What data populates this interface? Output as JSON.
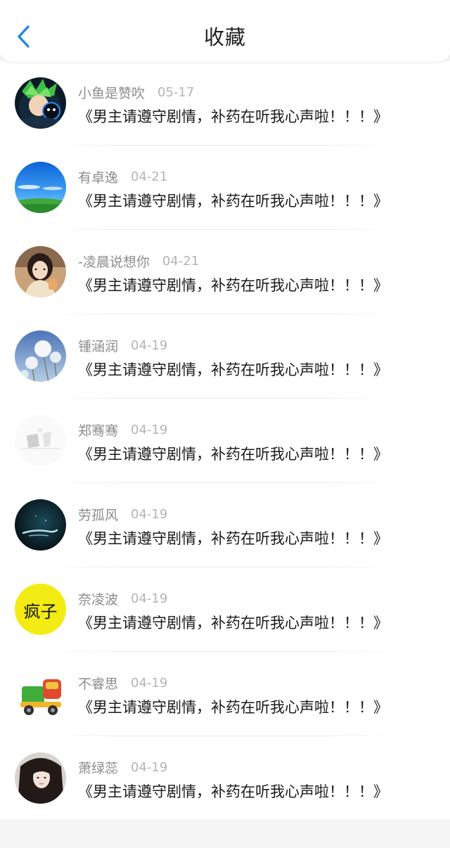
{
  "header": {
    "title": "收藏",
    "back_icon": "chevron-left-icon",
    "accent_color": "#1e88e5"
  },
  "items": [
    {
      "name": "小鱼是赞吹",
      "date": "05-17",
      "book": "《男主请遵守剧情，补药在听我心声啦！！！》",
      "avatar": "anime-character-green-hair"
    },
    {
      "name": "有卓逸",
      "date": "04-21",
      "book": "《男主请遵守剧情，补药在听我心声啦！！！》",
      "avatar": "blue-sky-grass"
    },
    {
      "name": "-凌晨说想你",
      "date": "04-21",
      "book": "《男主请遵守剧情，补药在听我心声啦！！！》",
      "avatar": "girl-portrait"
    },
    {
      "name": "锺涵润",
      "date": "04-19",
      "book": "《男主请遵守剧情，补药在听我心声啦！！！》",
      "avatar": "white-flowers"
    },
    {
      "name": "郑骞骞",
      "date": "04-19",
      "book": "《男主请遵守剧情，补药在听我心声啦！！！》",
      "avatar": "grey-sketch"
    },
    {
      "name": "劳孤风",
      "date": "04-19",
      "book": "《男主请遵守剧情，补药在听我心声啦！！！》",
      "avatar": "dark-underwater"
    },
    {
      "name": "奈凌波",
      "date": "04-19",
      "book": "《男主请遵守剧情，补药在听我心声啦！！！》",
      "avatar": "yellow-calligraphy",
      "avatar_text": "疯子"
    },
    {
      "name": "不睿思",
      "date": "04-19",
      "book": "《男主请遵守剧情，补药在听我心声啦！！！》",
      "avatar": "toy-truck"
    },
    {
      "name": "萧绿蕊",
      "date": "04-19",
      "book": "《男主请遵守剧情，补药在听我心声啦！！！》",
      "avatar": "girl-dark-hair"
    }
  ]
}
